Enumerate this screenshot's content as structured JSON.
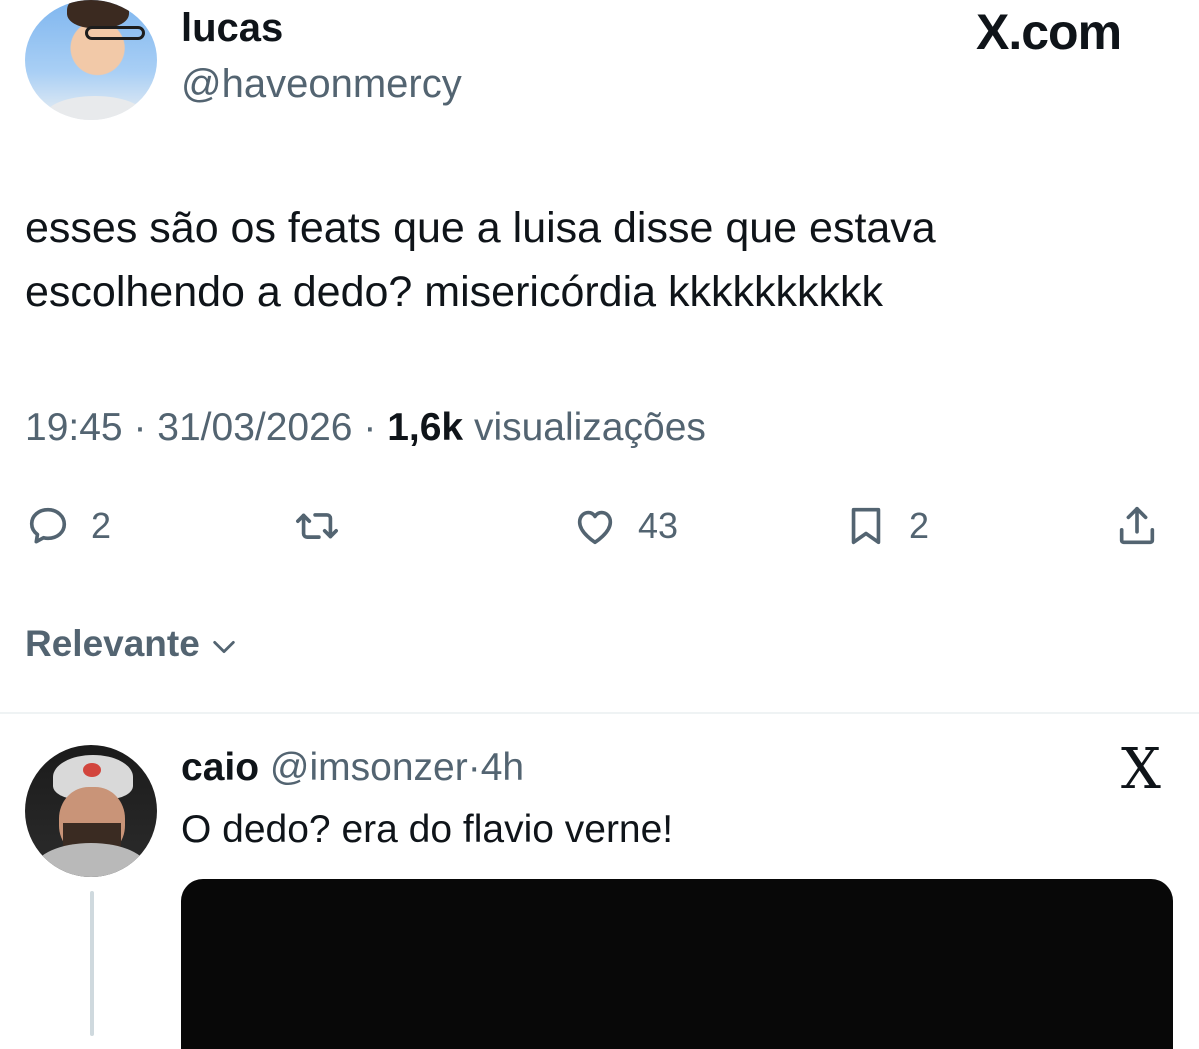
{
  "header": {
    "display_name": "lucas",
    "handle": "@haveonmercy",
    "site_label": "X.com"
  },
  "tweet": {
    "text": "esses são os feats que a luisa disse que estava\nescolhendo a dedo? misericórdia kkkkkkkkkk",
    "time": "19:45",
    "separator": "·",
    "date": "31/03/2026",
    "views_count": "1,6k",
    "views_label": "visualizações"
  },
  "actions": {
    "replies": "2",
    "likes": "43",
    "bookmarks": "2"
  },
  "sort": {
    "label": "Relevante"
  },
  "reply": {
    "display_name": "caio",
    "handle": "@imsonzer",
    "separator": "·",
    "age": "4h",
    "text": "O dedo? era do flavio verne!",
    "logo": "X"
  },
  "icons": {
    "reply": "speech-bubble-icon",
    "retweet": "retweet-icon",
    "like": "heart-icon",
    "bookmark": "bookmark-icon",
    "share": "share-icon",
    "sort": "chevron-down-icon"
  },
  "colors": {
    "text": "#0f1419",
    "secondary": "#536471",
    "divider": "#eff3f4"
  }
}
